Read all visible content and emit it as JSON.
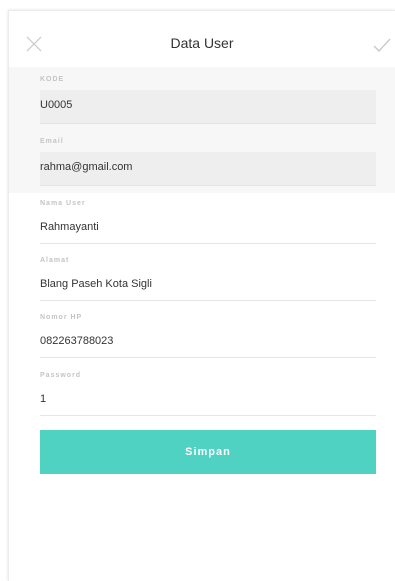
{
  "header": {
    "title": "Data User",
    "close_icon": "close-icon",
    "confirm_icon": "check-icon"
  },
  "form": {
    "kode": {
      "label": "KODE",
      "value": "U0005"
    },
    "email": {
      "label": "Email",
      "value": "rahma@gmail.com"
    },
    "nama_user": {
      "label": "Nama User",
      "value": "Rahmayanti"
    },
    "alamat": {
      "label": "Alamat",
      "value": "Blang Paseh Kota Sigli"
    },
    "nomor_hp": {
      "label": "Nomor HP",
      "value": "082263788023"
    },
    "password": {
      "label": "Password",
      "value": "1"
    }
  },
  "actions": {
    "save_label": "Simpan"
  },
  "colors": {
    "accent": "#4fd2c2",
    "readonly_bg": "#eeeeee"
  }
}
